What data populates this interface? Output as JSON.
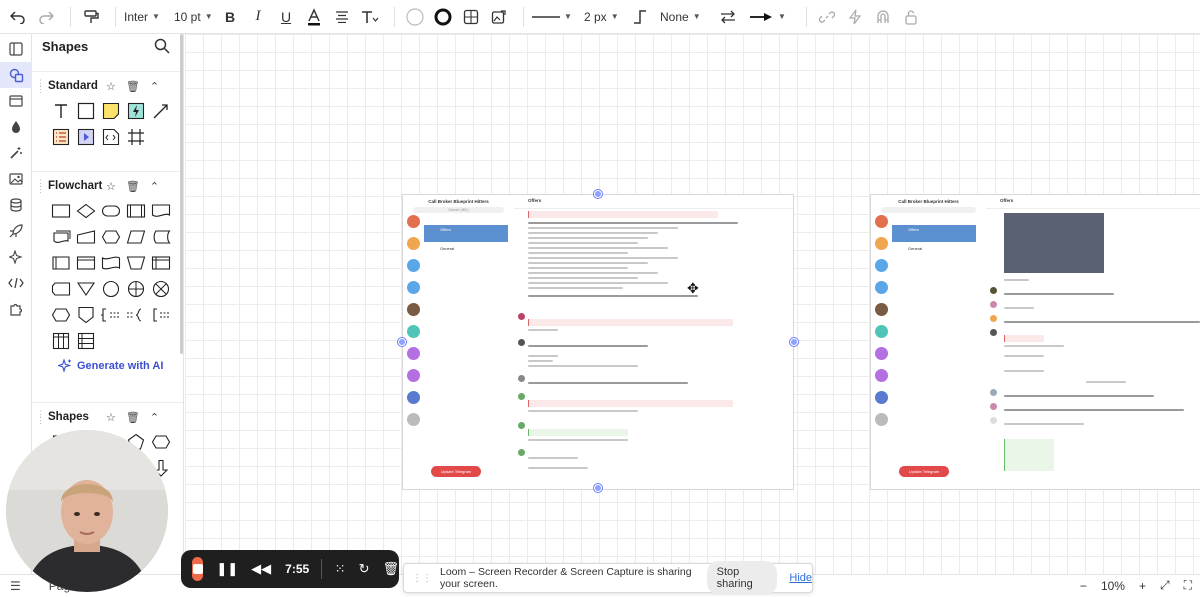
{
  "toolbar": {
    "font_family": "Inter",
    "font_size": "10 pt",
    "line_width": "2 px",
    "arrow_start": "None"
  },
  "panel": {
    "title": "Shapes",
    "sections": [
      {
        "name": "Standard"
      },
      {
        "name": "Flowchart"
      },
      {
        "name": "Shapes"
      }
    ],
    "generate_ai_label": "Generate with AI"
  },
  "canvas": {
    "shot_left": {
      "group_title": "Call Broker Blueprint Hitters",
      "chat_title": "Offers",
      "chat2_title": "General",
      "update_button": "Update Telegram",
      "search_placeholder": "Search (⌘K)"
    },
    "shot_right": {
      "group_title": "Call Broker Blueprint Hitters",
      "chat_title": "Offers",
      "chat2_title": "General",
      "update_button": "Update Telegram"
    }
  },
  "statusbar": {
    "page_label": "Pag",
    "zoom": "10%"
  },
  "loom": {
    "timer": "7:55"
  },
  "share_bar": {
    "message": "Loom – Screen Recorder & Screen Capture is sharing your screen.",
    "stop_label": "Stop sharing",
    "hide_label": "Hide"
  },
  "colors": {
    "accent": "#4a5cd6",
    "record": "#f06a4a",
    "telegram_red": "#e24a4a",
    "telegram_blue": "#5b8fd0"
  }
}
